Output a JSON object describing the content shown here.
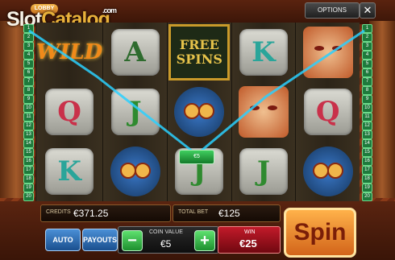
{
  "topbar": {
    "lobby_label": "LOBBY",
    "brand_slot": "Slot",
    "brand_catalog": "Catalog",
    "brand_com": ".com",
    "options_label": "OPTIONS",
    "close_glyph": "✕"
  },
  "paylines": {
    "left": [
      "1",
      "2",
      "3",
      "4",
      "5",
      "6",
      "7",
      "8",
      "9",
      "10",
      "11",
      "12",
      "13",
      "14",
      "15",
      "16",
      "17",
      "18",
      "19",
      "20",
      "21",
      "22",
      "23",
      "24",
      "25"
    ],
    "right": [
      "1",
      "2",
      "3",
      "4",
      "5",
      "6",
      "7",
      "8",
      "9",
      "10",
      "11",
      "12",
      "13",
      "14",
      "15",
      "16",
      "17",
      "18",
      "19",
      "20",
      "21",
      "22",
      "23",
      "24",
      "25"
    ]
  },
  "reels": [
    [
      "WILD",
      "Q",
      "K"
    ],
    [
      "A",
      "J",
      "OWL"
    ],
    [
      "FREE SPINS",
      "OWL",
      "J"
    ],
    [
      "K",
      "MASK",
      "J"
    ],
    [
      "MASK",
      "Q",
      "OWL"
    ]
  ],
  "free_spins": {
    "line1": "FREE",
    "line2": "SPINS"
  },
  "win_badge": "€5",
  "credits": {
    "label": "CREDITS",
    "value": "€371.25"
  },
  "total_bet": {
    "label": "TOTAL BET",
    "value": "€125"
  },
  "buttons": {
    "auto": "AUTO",
    "payouts": "PAYOUTS",
    "spin": "Spin",
    "minus": "−",
    "plus": "+"
  },
  "coin_value": {
    "label": "COIN VALUE",
    "value": "€5"
  },
  "win": {
    "label": "WIN",
    "value": "€25"
  },
  "colors": {
    "accent": "#f5a43a",
    "line_green": "#1e7a3c",
    "win_red": "#c21a2a"
  }
}
